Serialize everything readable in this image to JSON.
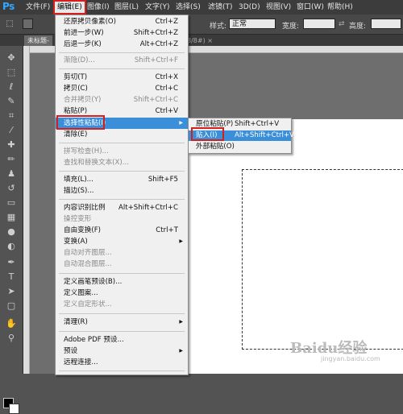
{
  "menubar": {
    "logo": "Ps",
    "items": [
      "文件(F)",
      "编辑(E)",
      "图像(I)",
      "图层(L)",
      "文字(Y)",
      "选择(S)",
      "滤镜(T)",
      "3D(D)",
      "视图(V)",
      "窗口(W)",
      "帮助(H)"
    ]
  },
  "optbar": {
    "style_label": "样式:",
    "style_value": "正常",
    "width_label": "宽度:",
    "height_label": "高度:"
  },
  "tabs": {
    "doc1": "未标题-",
    "doc2": "8/8#) ×"
  },
  "edit_menu": {
    "items": [
      {
        "label": "还原拷贝像素(O)",
        "shortcut": "Ctrl+Z"
      },
      {
        "label": "前进一步(W)",
        "shortcut": "Shift+Ctrl+Z"
      },
      {
        "label": "后退一步(K)",
        "shortcut": "Alt+Ctrl+Z"
      },
      {
        "label": "渐隐(D)...",
        "shortcut": "Shift+Ctrl+F"
      },
      {
        "label": "剪切(T)",
        "shortcut": "Ctrl+X"
      },
      {
        "label": "拷贝(C)",
        "shortcut": "Ctrl+C"
      },
      {
        "label": "合并拷贝(Y)",
        "shortcut": "Shift+Ctrl+C"
      },
      {
        "label": "粘贴(P)",
        "shortcut": "Ctrl+V"
      },
      {
        "label": "选择性粘贴(I)",
        "shortcut": ""
      },
      {
        "label": "清除(E)",
        "shortcut": ""
      },
      {
        "label": "拼写检查(H)...",
        "shortcut": ""
      },
      {
        "label": "查找和替换文本(X)...",
        "shortcut": ""
      },
      {
        "label": "填充(L)...",
        "shortcut": "Shift+F5"
      },
      {
        "label": "描边(S)...",
        "shortcut": ""
      },
      {
        "label": "内容识别比例",
        "shortcut": "Alt+Shift+Ctrl+C"
      },
      {
        "label": "操控变形",
        "shortcut": ""
      },
      {
        "label": "自由变换(F)",
        "shortcut": "Ctrl+T"
      },
      {
        "label": "变换(A)",
        "shortcut": ""
      },
      {
        "label": "自动对齐图层...",
        "shortcut": ""
      },
      {
        "label": "自动混合图层...",
        "shortcut": ""
      },
      {
        "label": "定义画笔预设(B)...",
        "shortcut": ""
      },
      {
        "label": "定义图案...",
        "shortcut": ""
      },
      {
        "label": "定义自定形状...",
        "shortcut": ""
      },
      {
        "label": "清理(R)",
        "shortcut": ""
      },
      {
        "label": "Adobe PDF 预设...",
        "shortcut": ""
      },
      {
        "label": "预设",
        "shortcut": ""
      },
      {
        "label": "远程连接...",
        "shortcut": ""
      }
    ]
  },
  "paste_special_submenu": {
    "items": [
      {
        "label": "原位粘贴(P)",
        "shortcut": "Shift+Ctrl+V"
      },
      {
        "label": "贴入(I)",
        "shortcut": "Alt+Shift+Ctrl+V"
      },
      {
        "label": "外部粘贴(O)",
        "shortcut": ""
      }
    ]
  },
  "watermark": {
    "brand": "Baidu经验",
    "url": "jingyan.baidu.com"
  },
  "colors": {
    "highlight": "#3b8fd8",
    "annotation_red": "#d21f1f",
    "menubar_bg": "#3c3c3c",
    "ps_blue": "#31a8ff"
  }
}
